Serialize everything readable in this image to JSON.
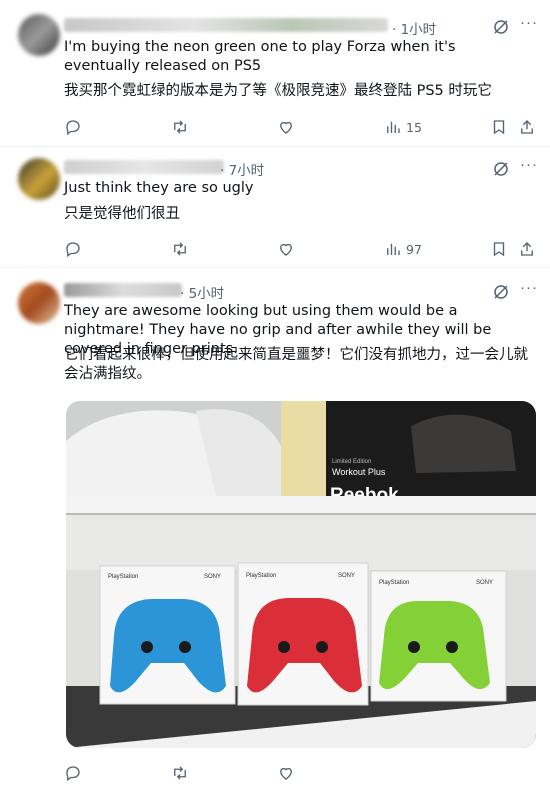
{
  "tweets": [
    {
      "time": "· 1小时",
      "text_en": "I'm buying the neon green one to play Forza when it's eventually released on PS5",
      "text_zh": "我买那个霓虹绿的版本是为了等《极限竞速》最终登陆 PS5 时玩它",
      "views": "15"
    },
    {
      "time": "· 7小时",
      "text_en": "Just think they are so ugly",
      "text_zh": "只是觉得他们很丑",
      "views": "97"
    },
    {
      "time": "· 5小时",
      "text_en": "They are awesome looking but using them would be a nightmare! They have no grip and after awhile they will be covered in finger prints.",
      "text_zh": "它们看起来很棒，但使用起来简直是噩梦！它们没有抓地力，过一会儿就会沾满指纹。"
    }
  ],
  "photo": {
    "box_left_label": "Limited Edition",
    "box_right_label": "Workout Plus",
    "brand": "Reebok",
    "ps_brand": "PlayStation",
    "sony": "SONY",
    "controller_colors": [
      "#1f8fd6",
      "#d8232c",
      "#7ccf2a"
    ]
  }
}
